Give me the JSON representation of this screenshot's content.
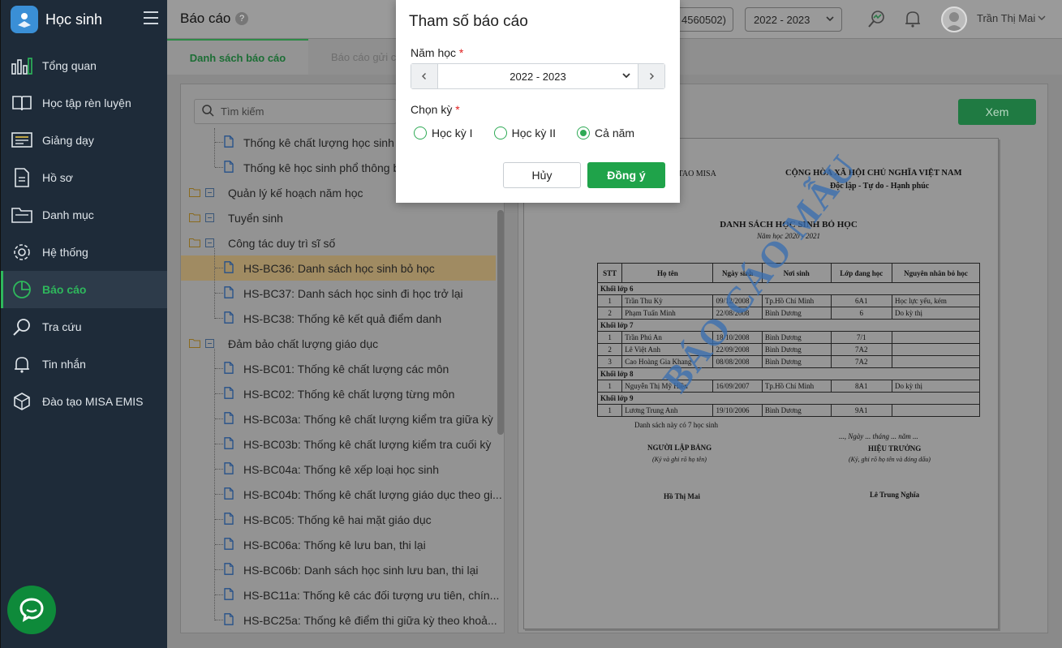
{
  "app": {
    "title": "Học sinh"
  },
  "sidebar": {
    "items": [
      {
        "label": "Tổng quan",
        "icon": "chart-bars-icon"
      },
      {
        "label": "Học tập rèn luyện",
        "icon": "book-icon"
      },
      {
        "label": "Giảng dạy",
        "icon": "teaching-icon"
      },
      {
        "label": "Hồ sơ",
        "icon": "document-icon"
      },
      {
        "label": "Danh mục",
        "icon": "folder-icon"
      },
      {
        "label": "Hệ thống",
        "icon": "gear-icon"
      },
      {
        "label": "Báo cáo",
        "icon": "pie-chart-icon",
        "active": true
      },
      {
        "label": "Tra cứu",
        "icon": "search-icon"
      },
      {
        "label": "Tin nhắn",
        "icon": "bell-icon"
      },
      {
        "label": "Đào tạo MISA EMIS",
        "icon": "cube-icon"
      }
    ]
  },
  "header": {
    "page_title": "Báo cáo",
    "help": "?",
    "school_code": "4560502)",
    "year": "2022 - 2023",
    "user_name": "Trần Thị Mai"
  },
  "tabs": {
    "list": "Danh sách báo cáo",
    "sent": "Báo cáo gửi c"
  },
  "search": {
    "placeholder": "Tìm kiếm"
  },
  "tree": [
    {
      "type": "doc",
      "label": "Thống kê chất lượng học sinh T"
    },
    {
      "type": "doc",
      "label": "Thống kê học sinh phổ thông bỏ"
    },
    {
      "type": "folder",
      "label": "Quản lý kế hoạch năm học"
    },
    {
      "type": "folder",
      "label": "Tuyển sinh"
    },
    {
      "type": "folder",
      "label": "Công tác duy trì sĩ số"
    },
    {
      "type": "doc",
      "label": "HS-BC36: Danh sách học sinh bỏ học",
      "selected": true
    },
    {
      "type": "doc",
      "label": "HS-BC37: Danh sách học sinh đi học trở lại"
    },
    {
      "type": "doc",
      "label": "HS-BC38: Thống kê kết quả điểm danh"
    },
    {
      "type": "folder",
      "label": "Đảm bảo chất lượng giáo dục"
    },
    {
      "type": "doc",
      "label": "HS-BC01: Thống kê chất lượng các môn"
    },
    {
      "type": "doc",
      "label": "HS-BC02: Thống kê chất lượng từng môn"
    },
    {
      "type": "doc",
      "label": "HS-BC03a: Thống kê chất lượng kiểm tra giữa kỳ"
    },
    {
      "type": "doc",
      "label": "HS-BC03b: Thống kê chất lượng kiểm tra cuối kỳ"
    },
    {
      "type": "doc",
      "label": "HS-BC04a: Thống kê xếp loại học sinh"
    },
    {
      "type": "doc",
      "label": "HS-BC04b: Thống kê chất lượng giáo dục theo gi..."
    },
    {
      "type": "doc",
      "label": "HS-BC05: Thống kê hai mặt giáo dục"
    },
    {
      "type": "doc",
      "label": "HS-BC06a: Thống kê lưu ban, thi lại"
    },
    {
      "type": "doc",
      "label": "HS-BC06b: Danh sách học sinh lưu ban, thi lại"
    },
    {
      "type": "doc",
      "label": "HS-BC11a: Thống kê các đối tượng ưu tiên, chín..."
    },
    {
      "type": "doc",
      "label": "HS-BC25a: Thống kê điểm thi giữa kỳ theo khoả..."
    }
  ],
  "preview": {
    "view_button": "Xem",
    "org": "O TAO MISA",
    "nation": "CỘNG HÒA XÃ HỘI CHỦ NGHĨA VIỆT NAM",
    "motto": "Độc lập - Tự do - Hạnh phúc",
    "title": "DANH SÁCH HỌC SINH BỎ HỌC",
    "year": "Năm học 2020 - 2021",
    "headers": [
      "STT",
      "Họ tên",
      "Ngày sinh",
      "Nơi sinh",
      "Lớp đang học",
      "Nguyên nhân bỏ học"
    ],
    "groups": [
      {
        "name": "Khối lớp 6",
        "rows": [
          [
            "1",
            "Trần Thu Kỳ",
            "09/12/2008",
            "Tp.Hồ Chí Minh",
            "6A1",
            "Học lực yếu, kém"
          ],
          [
            "2",
            "Phạm Tuấn Minh",
            "22/08/2008",
            "Bình Dương",
            "6",
            "Do kỳ thị"
          ]
        ]
      },
      {
        "name": "Khối lớp 7",
        "rows": [
          [
            "1",
            "Trần Phú An",
            "18/10/2008",
            "Bình Dương",
            "7/1",
            ""
          ],
          [
            "2",
            "Lê Việt Anh",
            "22/09/2008",
            "Bình Dương",
            "7A2",
            ""
          ],
          [
            "3",
            "Cao Hoàng Gia Khang",
            "08/08/2008",
            "Bình Dương",
            "7A2",
            ""
          ]
        ]
      },
      {
        "name": "Khối lớp 8",
        "rows": [
          [
            "1",
            "Nguyễn Thị Mỹ Hiền",
            "16/09/2007",
            "Tp.Hồ Chí Minh",
            "8A1",
            "Do kỳ thị"
          ]
        ]
      },
      {
        "name": "Khối lớp 9",
        "rows": [
          [
            "1",
            "Lương Trung Anh",
            "19/10/2006",
            "Bình Dương",
            "9A1",
            ""
          ]
        ]
      }
    ],
    "note": "Danh sách này có 7 học sinh",
    "date_line": "..., Ngày ... tháng ... năm ...",
    "signer1_title": "NGƯỜI LẬP BẢNG",
    "signer1_sub": "(Ký và ghi rõ họ tên)",
    "signer2_title": "HIỆU TRƯỞNG",
    "signer2_sub": "(Ký, ghi rõ họ tên và đóng dấu)",
    "signer1_name": "Hồ Thị Mai",
    "signer2_name": "Lê Trung Nghĩa",
    "watermark": "BÁO CÁO MẪU"
  },
  "modal": {
    "title": "Tham số báo cáo",
    "year_label": "Năm học",
    "year_value": "2022 - 2023",
    "term_label": "Chọn kỳ",
    "required_mark": "*",
    "terms": [
      "Học kỳ I",
      "Học kỳ II",
      "Cả năm"
    ],
    "selected_term": "Cả năm",
    "cancel": "Hủy",
    "ok": "Đồng ý"
  },
  "colors": {
    "accent": "#1fa34a",
    "sidebar": "#1e2b39",
    "watermark": "#3a6fb0"
  }
}
